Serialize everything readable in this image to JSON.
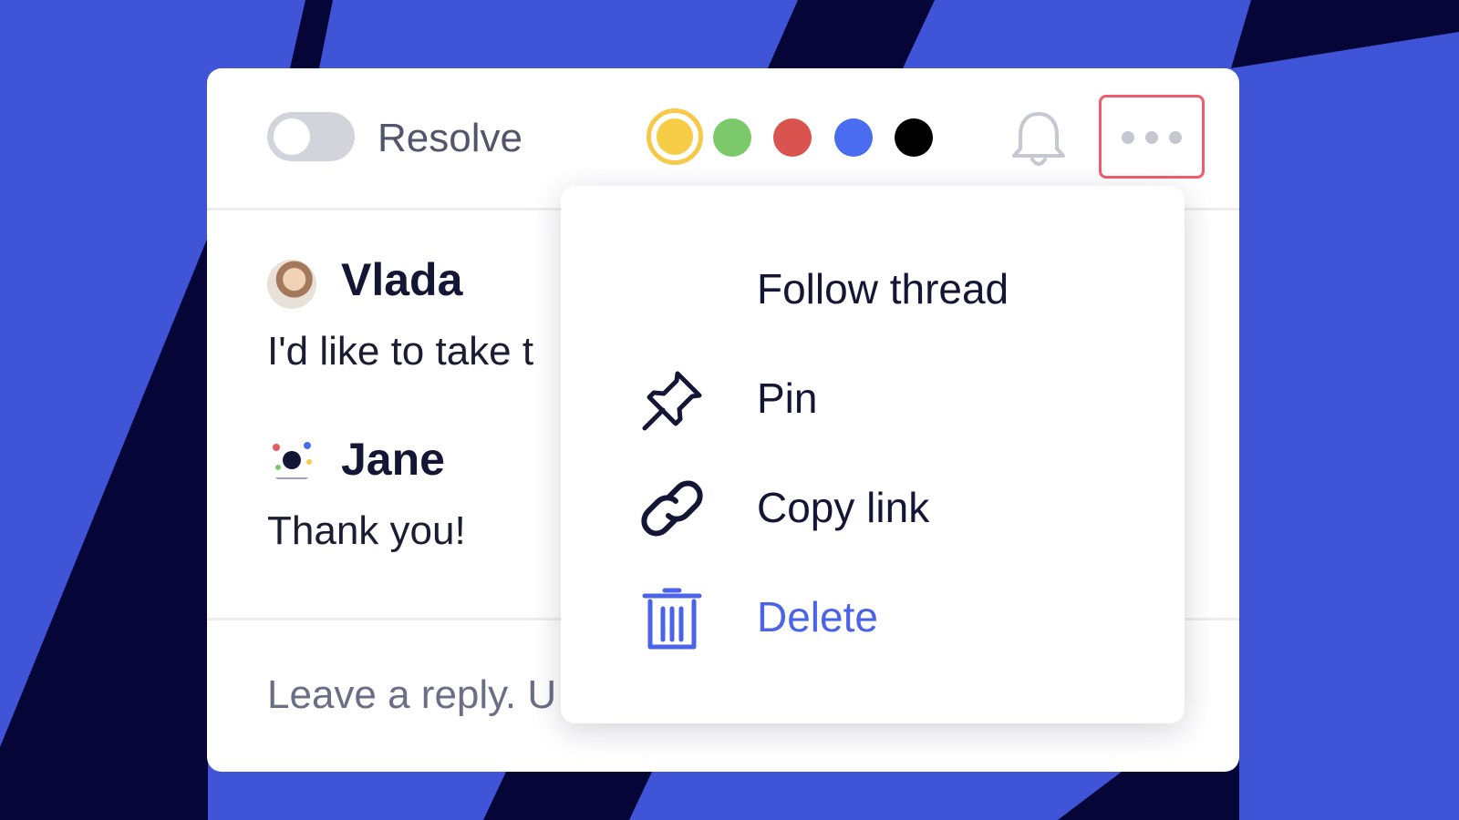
{
  "thread": {
    "resolve_label": "Resolve",
    "resolved": false,
    "colors": [
      {
        "name": "yellow",
        "hex": "#f7cd48",
        "selected": true
      },
      {
        "name": "green",
        "hex": "#7bc96a",
        "selected": false
      },
      {
        "name": "red",
        "hex": "#d9534f",
        "selected": false
      },
      {
        "name": "blue",
        "hex": "#4a6cf0",
        "selected": false
      },
      {
        "name": "black",
        "hex": "#000000",
        "selected": false
      }
    ],
    "bell_icon": "bell-icon",
    "more_icon": "more-horizontal-icon"
  },
  "comments": [
    {
      "author": "Vlada",
      "text": "I'd like to take t",
      "avatar": "avatar-photo"
    },
    {
      "author": "Jane",
      "text": "Thank you!",
      "avatar": "avatar-illustration"
    }
  ],
  "reply": {
    "placeholder": "Leave a reply. U"
  },
  "menu": {
    "items": [
      {
        "label": "Follow thread",
        "icon": ""
      },
      {
        "label": "Pin",
        "icon": "pin-icon"
      },
      {
        "label": "Copy link",
        "icon": "link-icon"
      },
      {
        "label": "Delete",
        "icon": "trash-icon"
      }
    ]
  },
  "theme": {
    "background": "#3f54d6",
    "stripe": "#050637",
    "danger_accent": "#4a63e8",
    "highlight": "#f25b6e"
  }
}
